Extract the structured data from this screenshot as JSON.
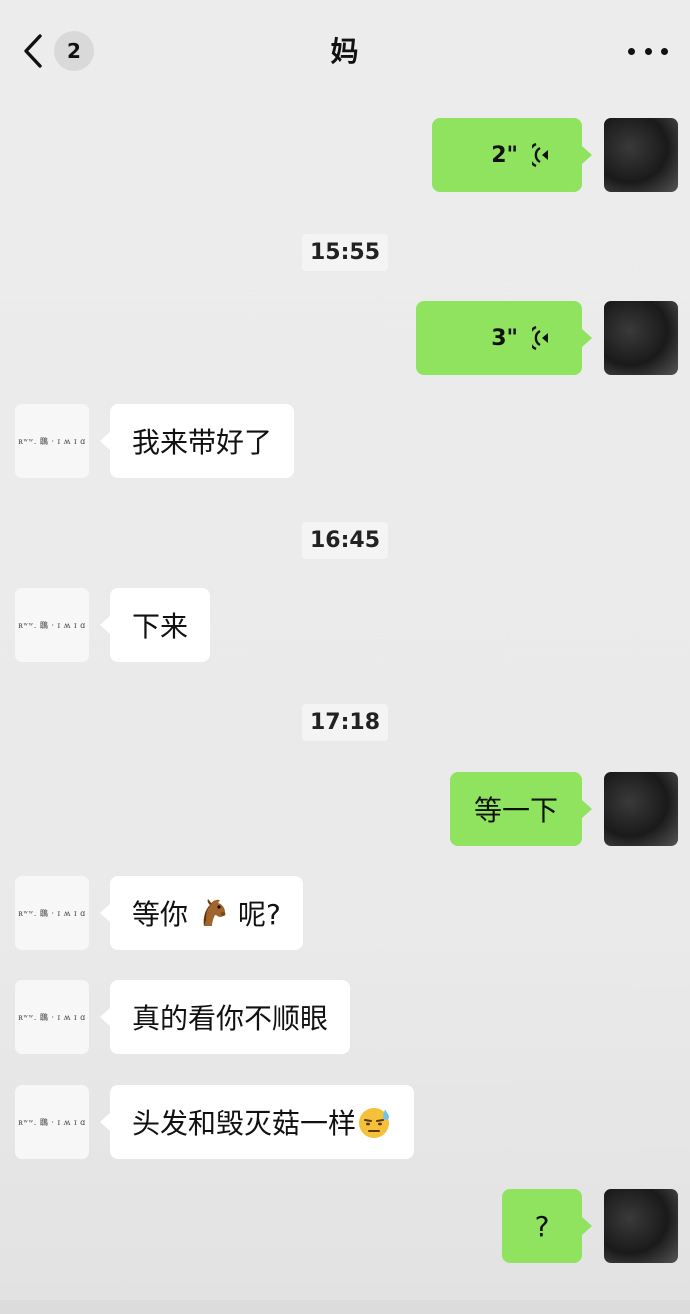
{
  "header": {
    "back_badge": "2",
    "title": "妈",
    "icons": {
      "back": "chevron-left-icon",
      "more": "more-dots-icon"
    }
  },
  "colors": {
    "sent_bubble": "#8fe35f",
    "received_bubble": "#ffffff",
    "background": "#ececec"
  },
  "messages": [
    {
      "type": "voice",
      "side": "right",
      "duration": "2\""
    },
    {
      "type": "timestamp",
      "text": "15:55"
    },
    {
      "type": "voice",
      "side": "right",
      "duration": "3\""
    },
    {
      "type": "text",
      "side": "left",
      "text": "我来带好了"
    },
    {
      "type": "timestamp",
      "text": "16:45"
    },
    {
      "type": "text",
      "side": "left",
      "text": "下来"
    },
    {
      "type": "timestamp",
      "text": "17:18"
    },
    {
      "type": "text",
      "side": "right",
      "text": "等一下"
    },
    {
      "type": "text",
      "side": "left",
      "text_before": "等你",
      "emoji": "horse-emoji",
      "text_after": "呢?"
    },
    {
      "type": "text",
      "side": "left",
      "text": "真的看你不顺眼"
    },
    {
      "type": "text",
      "side": "left",
      "text": "头发和毁灭菇一样",
      "emoji": "sweat-face-emoji"
    },
    {
      "type": "text",
      "side": "right",
      "text": "?"
    }
  ]
}
